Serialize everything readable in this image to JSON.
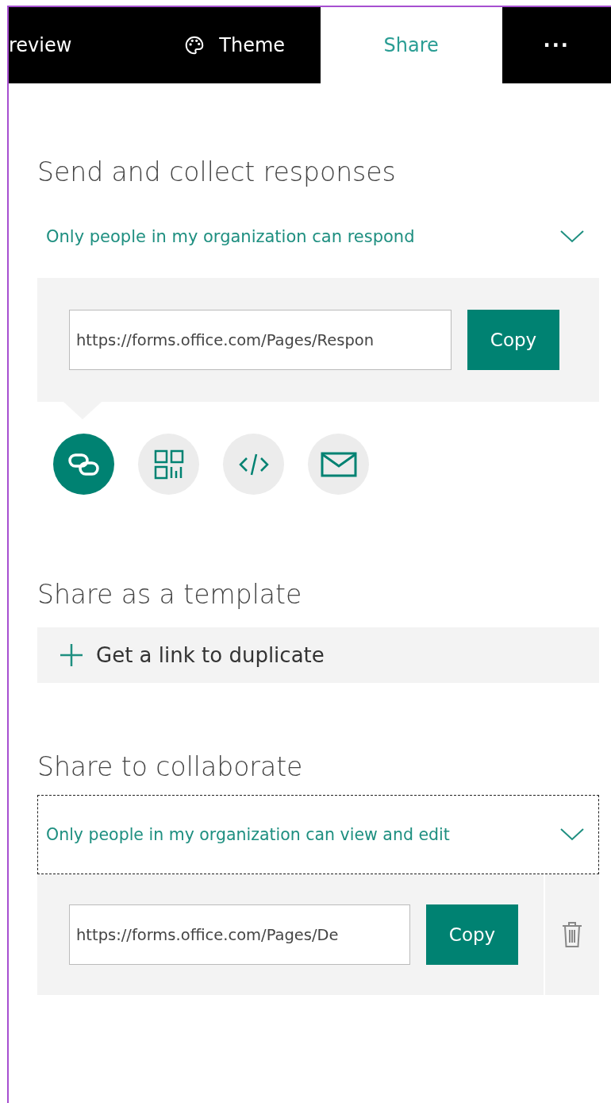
{
  "tabs": [
    {
      "label": "review",
      "kind": "text",
      "selected": false
    },
    {
      "label": "Theme",
      "kind": "theme",
      "selected": false
    },
    {
      "label": "Share",
      "kind": "text",
      "selected": true
    },
    {
      "label": "···",
      "kind": "more",
      "selected": false
    }
  ],
  "send": {
    "heading": "Send and collect responses",
    "dropdown": "Only people in my organization can respond",
    "url": "https://forms.office.com/Pages/Respon",
    "copy": "Copy",
    "options": [
      {
        "kind": "link",
        "selected": true
      },
      {
        "kind": "qr",
        "selected": false
      },
      {
        "kind": "embed",
        "selected": false
      },
      {
        "kind": "email",
        "selected": false
      }
    ]
  },
  "template": {
    "heading": "Share as a template",
    "action": "Get a link to duplicate"
  },
  "collaborate": {
    "heading": "Share to collaborate",
    "dropdown": "Only people in my organization can view and edit",
    "focused": true,
    "url": "https://forms.office.com/Pages/De",
    "copy": "Copy"
  }
}
